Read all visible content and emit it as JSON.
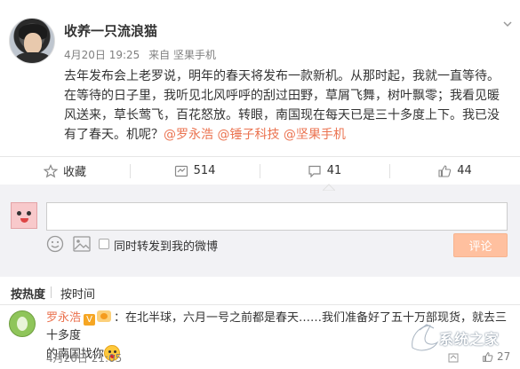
{
  "post": {
    "author": "收养一只流浪猫",
    "time": "4月20日 19:25",
    "source": "来自 坚果手机",
    "text_line1": "去年发布会上老罗说，明年的春天将发布一款新机。从那时起，我就一直等待。",
    "text_line2": "在等待的日子里，我听见北风呼呼的刮过田野，草屑飞舞，树叶飘零；我看见暖",
    "text_line3": "风送来，草长莺飞，百花怒放。转眼，南国现在每天已是三十多度上下。我已没",
    "text_line4_plain": "有了春天。机呢？",
    "mentions": [
      "@罗永浩",
      "@锤子科技",
      "@坚果手机"
    ]
  },
  "actions": {
    "favorite_label": "收藏",
    "repost_count": "514",
    "comment_count": "41",
    "like_count": "44"
  },
  "comment_box": {
    "placeholder": "",
    "repost_label": "同时转发到我的微博",
    "submit_label": "评论"
  },
  "sort": {
    "hot_label": "按热度",
    "time_label": "按时间"
  },
  "reply": {
    "name": "罗永浩",
    "verified_badge": "V",
    "text_part1": "：在北半球，六月一号之前都是春天……我们准备好了五十万部现货，就去三十多度",
    "text_part2": "的南国找你",
    "time": "4月20日 21:05",
    "likes": "27"
  },
  "watermark": {
    "text": "系统之家"
  },
  "colors": {
    "accent": "#eb7350",
    "submit_bg": "#ffc09f",
    "comment_area_bg": "#f2f2f5",
    "meta_gray": "#808080"
  },
  "icons": {
    "favorite": "star-icon",
    "repost": "repost-icon",
    "comment": "comment-icon",
    "like": "thumbs-up-icon",
    "emoji": "smiley-icon",
    "image": "image-icon",
    "dropdown": "chevron-down-icon"
  }
}
